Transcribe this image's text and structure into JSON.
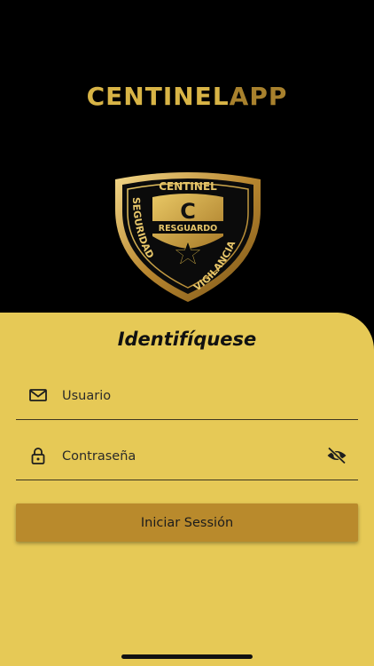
{
  "header": {
    "title_part1": "CENTINEL",
    "title_part2": "APP"
  },
  "logo": {
    "top_text": "CENTINEL",
    "letter": "C",
    "center_text": "RESGUARDO",
    "left_text": "SEGURIDAD",
    "right_text": "VIGILANCIA",
    "emblem": "star-icon"
  },
  "login": {
    "heading": "Identifíquese",
    "username_placeholder": "Usuario",
    "password_placeholder": "Contraseña",
    "submit_label": "Iniciar Sessión"
  },
  "colors": {
    "background": "#000000",
    "panel": "#e6c956",
    "button": "#b98a2c",
    "title_gold": "#d8b446",
    "title_dark_gold": "#a8812d"
  },
  "icons": {
    "username": "mail-icon",
    "password": "lock-icon",
    "visibility": "eye-off-icon"
  }
}
